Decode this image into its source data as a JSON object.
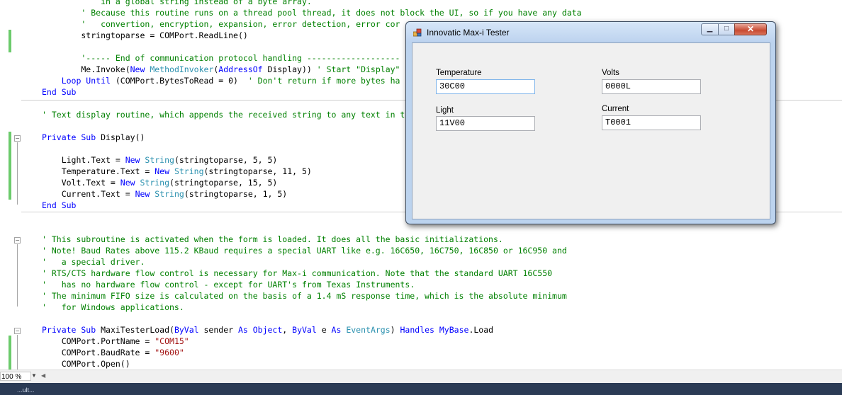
{
  "editor": {
    "lines": [
      {
        "segments": [
          {
            "c": "cm",
            "t": "            in a global string instead of a byte array."
          }
        ]
      },
      {
        "segments": [
          {
            "c": "cm",
            "t": "        ' Because this routine runs on a thread pool thread, it does not block the UI, so if you have any data"
          }
        ]
      },
      {
        "segments": [
          {
            "c": "cm",
            "t": "        '   convertion, encryption, expansion, error detection, error cor"
          }
        ]
      },
      {
        "segments": [
          {
            "c": "",
            "t": "        stringtoparse = COMPort.ReadLine()"
          }
        ]
      },
      {
        "segments": [
          {
            "c": "",
            "t": ""
          }
        ]
      },
      {
        "segments": [
          {
            "c": "cm",
            "t": "        '----- End of communication protocol handling -------------------"
          }
        ]
      },
      {
        "segments": [
          {
            "c": "",
            "t": "        Me.Invoke("
          },
          {
            "c": "kw",
            "t": "New "
          },
          {
            "c": "ty",
            "t": "MethodInvoker"
          },
          {
            "c": "",
            "t": "("
          },
          {
            "c": "kw",
            "t": "AddressOf"
          },
          {
            "c": "",
            "t": " Display)) "
          },
          {
            "c": "cm",
            "t": "' Start \"Display\""
          }
        ]
      },
      {
        "segments": [
          {
            "c": "kw",
            "t": "    Loop Until"
          },
          {
            "c": "",
            "t": " (COMPort.BytesToRead = 0)  "
          },
          {
            "c": "cm",
            "t": "' Don't return if more bytes ha"
          }
        ]
      },
      {
        "segments": [
          {
            "c": "kw",
            "t": "End Sub"
          }
        ]
      },
      {
        "segments": [
          {
            "c": "",
            "t": ""
          }
        ]
      },
      {
        "segments": [
          {
            "c": "cm",
            "t": "' Text display routine, which appends the received string to any text in t"
          }
        ]
      },
      {
        "segments": [
          {
            "c": "",
            "t": ""
          }
        ]
      },
      {
        "segments": [
          {
            "c": "kw",
            "t": "Private Sub"
          },
          {
            "c": "",
            "t": " Display()"
          }
        ]
      },
      {
        "segments": [
          {
            "c": "",
            "t": ""
          }
        ]
      },
      {
        "segments": [
          {
            "c": "",
            "t": "    Light.Text = "
          },
          {
            "c": "kw",
            "t": "New "
          },
          {
            "c": "ty",
            "t": "String"
          },
          {
            "c": "",
            "t": "(stringtoparse, 5, 5)"
          }
        ]
      },
      {
        "segments": [
          {
            "c": "",
            "t": "    Temperature.Text = "
          },
          {
            "c": "kw",
            "t": "New "
          },
          {
            "c": "ty",
            "t": "String"
          },
          {
            "c": "",
            "t": "(stringtoparse, 11, 5)"
          }
        ]
      },
      {
        "segments": [
          {
            "c": "",
            "t": "    Volt.Text = "
          },
          {
            "c": "kw",
            "t": "New "
          },
          {
            "c": "ty",
            "t": "String"
          },
          {
            "c": "",
            "t": "(stringtoparse, 15, 5)"
          }
        ]
      },
      {
        "segments": [
          {
            "c": "",
            "t": "    Current.Text = "
          },
          {
            "c": "kw",
            "t": "New "
          },
          {
            "c": "ty",
            "t": "String"
          },
          {
            "c": "",
            "t": "(stringtoparse, 1, 5)"
          }
        ]
      },
      {
        "segments": [
          {
            "c": "kw",
            "t": "End Sub"
          }
        ]
      },
      {
        "segments": [
          {
            "c": "",
            "t": ""
          }
        ]
      },
      {
        "segments": [
          {
            "c": "",
            "t": ""
          }
        ]
      },
      {
        "segments": [
          {
            "c": "cm",
            "t": "' This subroutine is activated when the form is loaded. It does all the basic initializations."
          }
        ]
      },
      {
        "segments": [
          {
            "c": "cm",
            "t": "' Note! Baud Rates above 115.2 KBaud requires a special UART like e.g. 16C650, 16C750, 16C850 or 16C950 and"
          }
        ]
      },
      {
        "segments": [
          {
            "c": "cm",
            "t": "'   a special driver."
          }
        ]
      },
      {
        "segments": [
          {
            "c": "cm",
            "t": "' RTS/CTS hardware flow control is necessary for Max-i communication. Note that the standard UART 16C550"
          }
        ]
      },
      {
        "segments": [
          {
            "c": "cm",
            "t": "'   has no hardware flow control - except for UART's from Texas Instruments."
          }
        ]
      },
      {
        "segments": [
          {
            "c": "cm",
            "t": "' The minimum FIFO size is calculated on the basis of a 1.4 mS response time, which is the absolute minimum"
          }
        ]
      },
      {
        "segments": [
          {
            "c": "cm",
            "t": "'   for Windows applications."
          }
        ]
      },
      {
        "segments": [
          {
            "c": "",
            "t": ""
          }
        ]
      },
      {
        "segments": [
          {
            "c": "kw",
            "t": "Private Sub"
          },
          {
            "c": "",
            "t": " MaxiTesterLoad("
          },
          {
            "c": "kw",
            "t": "ByVal"
          },
          {
            "c": "",
            "t": " sender "
          },
          {
            "c": "kw",
            "t": "As Object"
          },
          {
            "c": "",
            "t": ", "
          },
          {
            "c": "kw",
            "t": "ByVal"
          },
          {
            "c": "",
            "t": " e "
          },
          {
            "c": "kw",
            "t": "As "
          },
          {
            "c": "ty",
            "t": "EventArgs"
          },
          {
            "c": "",
            "t": ") "
          },
          {
            "c": "kw",
            "t": "Handles MyBase"
          },
          {
            "c": "",
            "t": ".Load"
          }
        ]
      },
      {
        "segments": [
          {
            "c": "",
            "t": "    COMPort.PortName = "
          },
          {
            "c": "st",
            "t": "\"COM15\""
          }
        ]
      },
      {
        "segments": [
          {
            "c": "",
            "t": "    COMPort.BaudRate = "
          },
          {
            "c": "st",
            "t": "\"9600\""
          }
        ]
      },
      {
        "segments": [
          {
            "c": "",
            "t": "    COMPort.Open()"
          }
        ]
      }
    ],
    "zoom": "100 %"
  },
  "dialog": {
    "title": "Innovatic Max-i Tester",
    "fields": {
      "temperature": {
        "label": "Temperature",
        "value": "30C00"
      },
      "volts": {
        "label": "Volts",
        "value": "0000L"
      },
      "light": {
        "label": "Light",
        "value": "11V00"
      },
      "current": {
        "label": "Current",
        "value": "T0001"
      }
    }
  },
  "status": {
    "text": "...ult..."
  }
}
